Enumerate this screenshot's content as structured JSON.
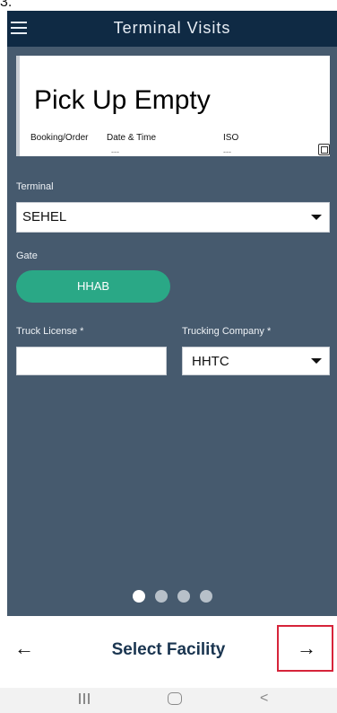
{
  "status_bar": {
    "text": "3."
  },
  "app_bar": {
    "title": "Terminal Visits",
    "menu_icon": "hamburger-menu-icon"
  },
  "card": {
    "title": "Pick Up Empty",
    "columns": [
      {
        "label": "Booking/Order",
        "value": ""
      },
      {
        "label": "Date & Time",
        "value": "---"
      },
      {
        "label": "ISO",
        "value": "---"
      }
    ],
    "icon": "document-icon"
  },
  "terminal": {
    "label": "Terminal",
    "value": "SEHEL"
  },
  "gate": {
    "label": "Gate",
    "value": "HHAB"
  },
  "truck_license": {
    "label": "Truck License *",
    "value": ""
  },
  "trucking_company": {
    "label": "Trucking Company *",
    "value": "HHTC"
  },
  "pager": {
    "total": 4,
    "active": 1
  },
  "bottom_nav": {
    "back": "←",
    "title": "Select Facility",
    "next": "→"
  },
  "system_nav": {
    "recents_icon": "recents-icon",
    "home_icon": "home-icon",
    "back_icon": "back-chevron-icon",
    "back_glyph": "<"
  }
}
